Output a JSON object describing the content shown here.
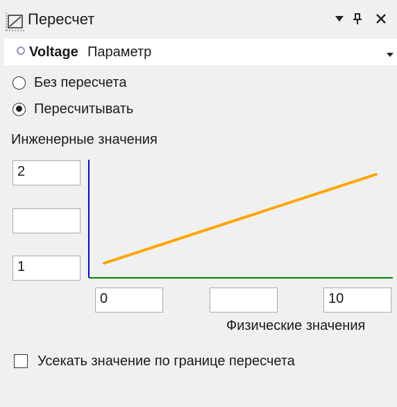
{
  "window": {
    "title": "Пересчет",
    "icons": {
      "title": "recalc-chart-icon",
      "menu": "dropdown-triangle-icon",
      "pin": "pin-icon",
      "close": "close-icon"
    }
  },
  "parameter": {
    "name": "Voltage",
    "type": "Параметр",
    "status_icon": "parameter-circle-icon",
    "dropdown_icon": "chevron-down-icon"
  },
  "mode": {
    "options": [
      {
        "label": "Без пересчета",
        "selected": false
      },
      {
        "label": "Пересчитывать",
        "selected": true
      }
    ]
  },
  "engineering": {
    "label": "Инженерные значения",
    "fields": {
      "top": "2",
      "middle": "",
      "bottom": "1"
    }
  },
  "physical": {
    "label": "Физические значения",
    "fields": {
      "left": "0",
      "middle": "",
      "right": "10"
    }
  },
  "chart_data": {
    "type": "line",
    "title": "",
    "xlabel": "Физические значения",
    "ylabel": "Инженерные значения",
    "xlim": [
      0,
      10
    ],
    "ylim": [
      1,
      2
    ],
    "series": [
      {
        "x": [
          0,
          10
        ],
        "y": [
          1,
          2
        ]
      }
    ],
    "colors": {
      "line": "#ffa500",
      "y_axis": "#0000ff",
      "x_axis": "#008000"
    }
  },
  "clip": {
    "label": "Усекать значение по границе пересчета",
    "checked": false
  }
}
